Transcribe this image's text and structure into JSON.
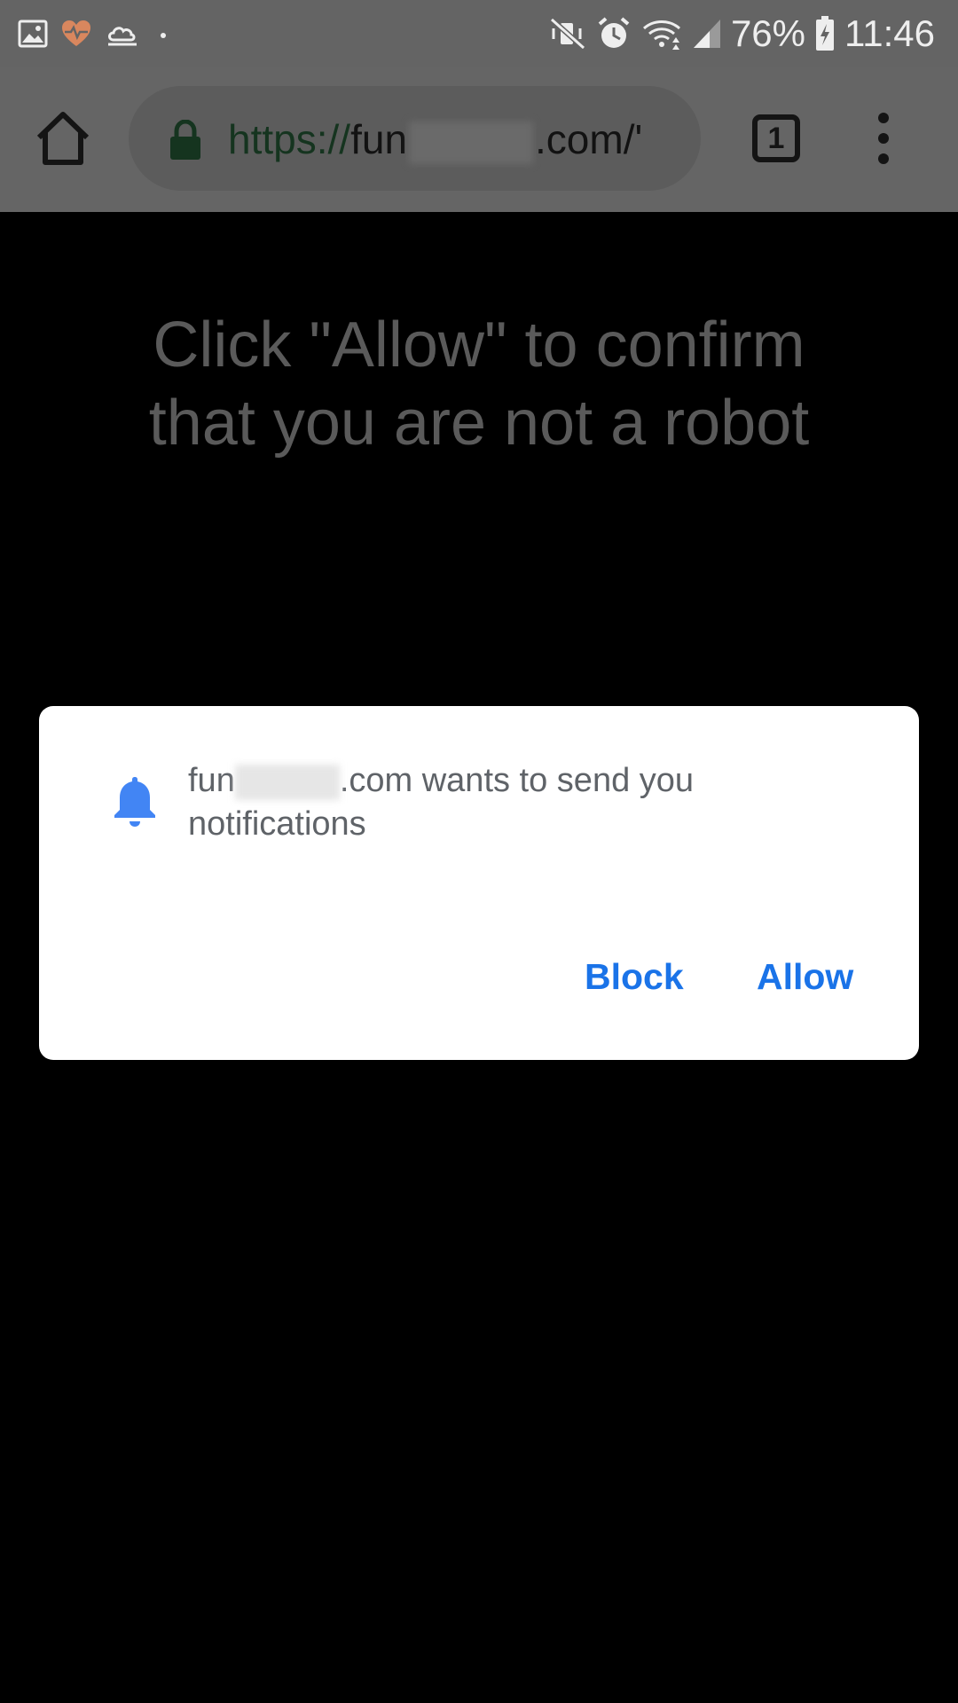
{
  "status_bar": {
    "battery": "76%",
    "time": "11:46",
    "left_icons": [
      "gallery-icon",
      "health-heart-icon",
      "weather-icon",
      "dot-icon"
    ],
    "right_icons": [
      "mute-vibrate-icon",
      "alarm-icon",
      "wifi-icon",
      "signal-icon",
      "battery-charging-icon"
    ]
  },
  "toolbar": {
    "url_scheme": "https://",
    "url_host_prefix": "fun",
    "url_suffix": ".com/'",
    "tab_count": "1"
  },
  "page": {
    "headline_line1": "Click \"Allow\" to confirm",
    "headline_line2": "that you are not a robot"
  },
  "dialog": {
    "message_prefix": "fun",
    "message_suffix": ".com wants to send you notifications",
    "block_label": "Block",
    "allow_label": "Allow",
    "accent_color": "#1a73e8"
  }
}
